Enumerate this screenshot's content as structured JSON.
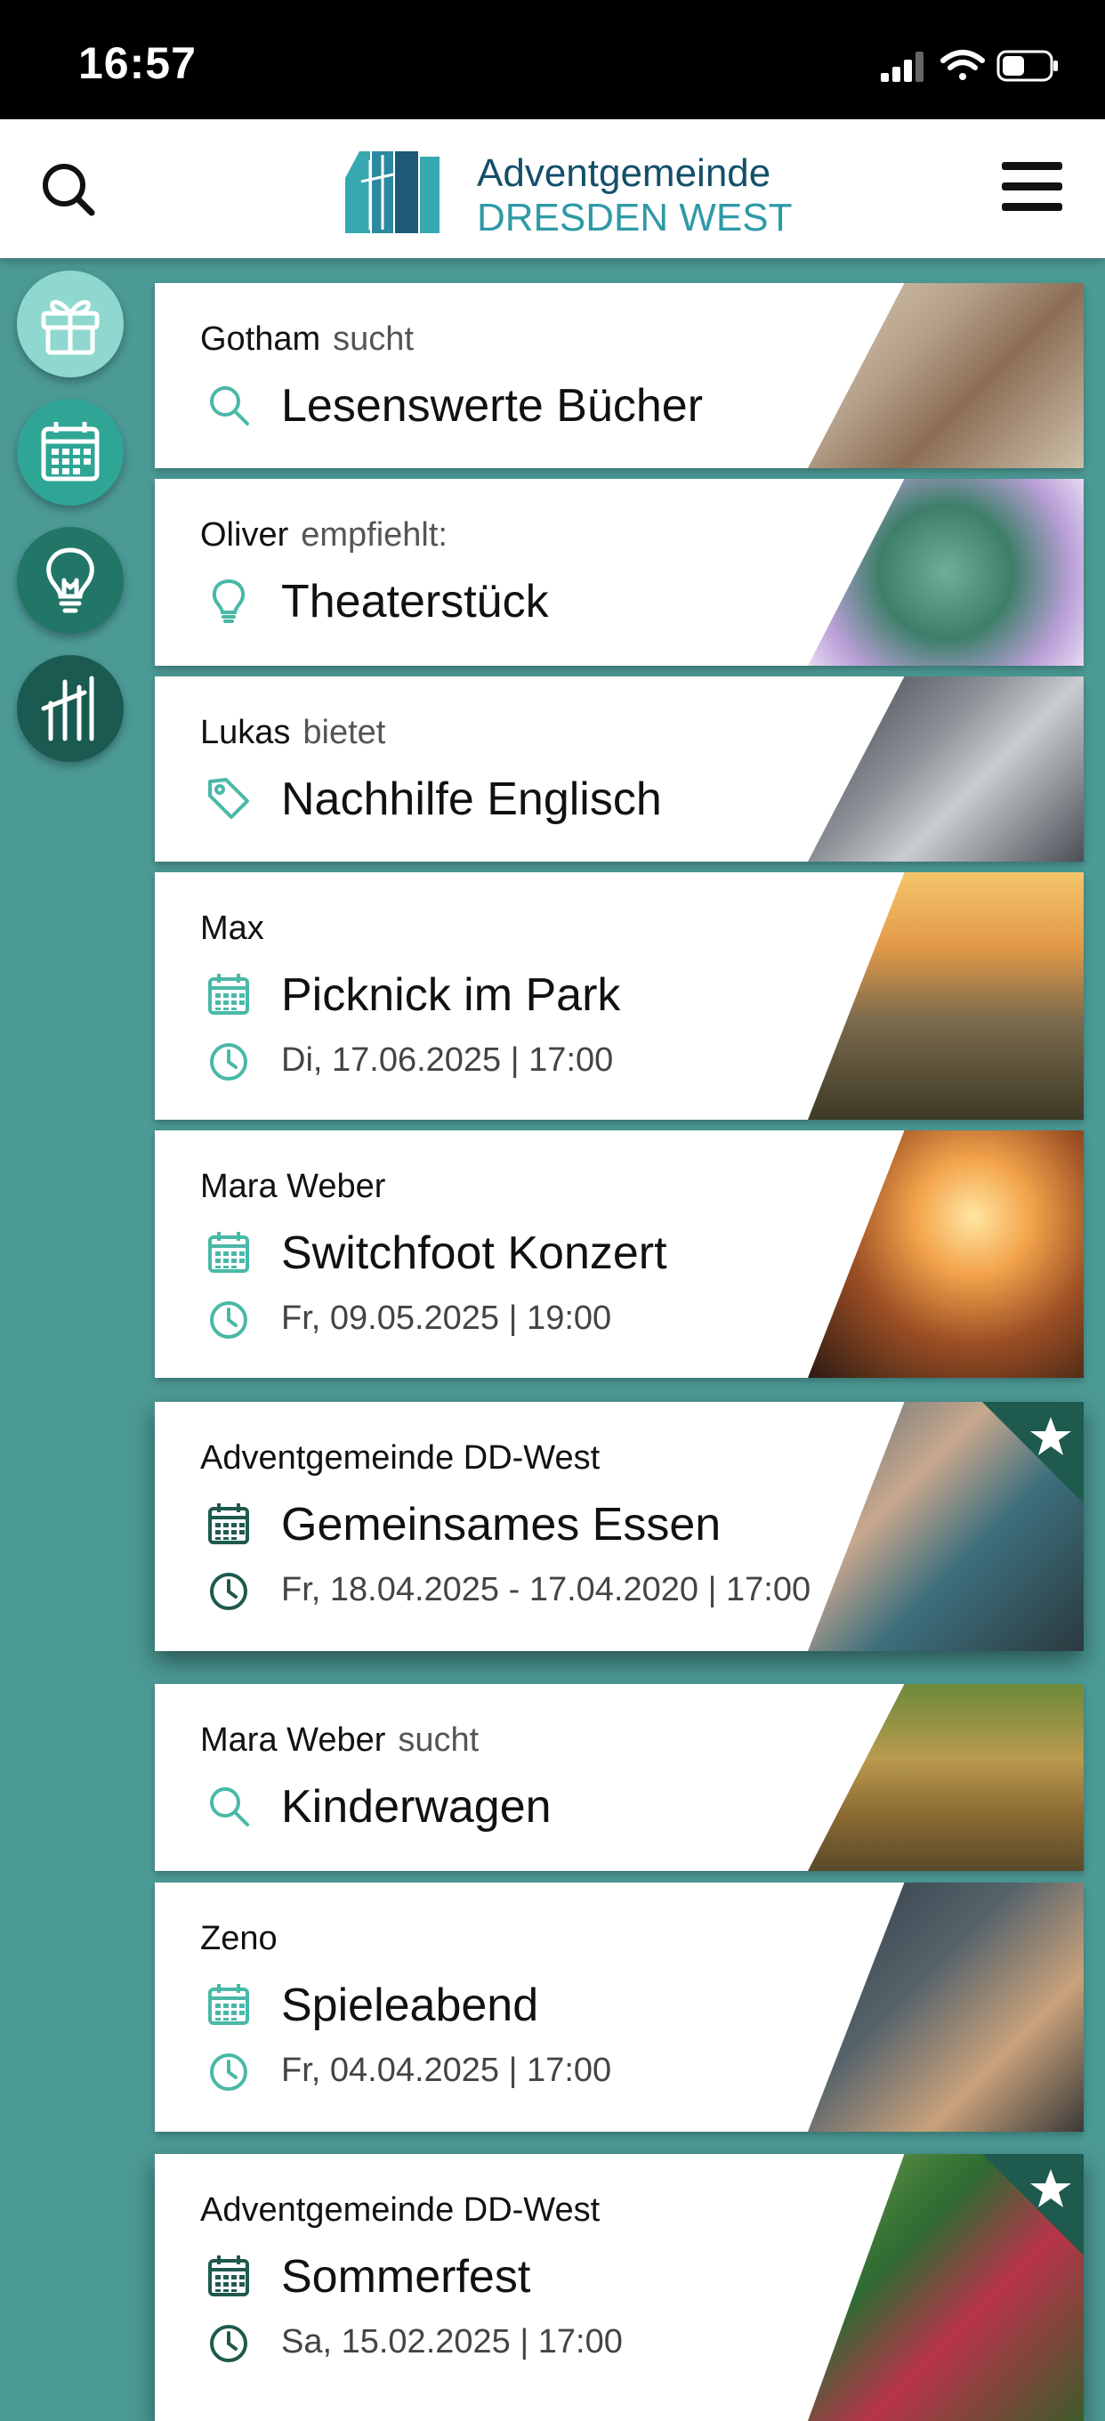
{
  "status_bar": {
    "time": "16:57"
  },
  "header": {
    "logo_line1": "Adventgemeinde",
    "logo_line2": "DRESDEN WEST"
  },
  "sidebar": [
    {
      "name": "gift-icon",
      "color": "#8fd8cf"
    },
    {
      "name": "calendar-icon",
      "color": "#2fa595"
    },
    {
      "name": "lightbulb-icon",
      "color": "#217667"
    },
    {
      "name": "church-logo-icon",
      "color": "#1a5a50"
    }
  ],
  "cards": [
    {
      "author": "Gotham",
      "verb": "sucht",
      "type_icon": "search-icon",
      "title": "Lesenswerte Bücher",
      "date": "",
      "featured": false,
      "photo": "book-pages-photo"
    },
    {
      "author": "Oliver",
      "verb": "empfiehlt:",
      "type_icon": "lightbulb-icon",
      "title": "Theaterstück",
      "date": "",
      "featured": false,
      "photo": "succulent-photo"
    },
    {
      "author": "Lukas",
      "verb": "bietet",
      "type_icon": "tag-icon",
      "title": "Nachhilfe Englisch",
      "date": "",
      "featured": false,
      "photo": "writing-desk-photo"
    },
    {
      "author": "Max",
      "verb": "",
      "type_icon": "calendar-icon",
      "title": "Picknick im Park",
      "date": "Di, 17.06.2025 | 17:00",
      "featured": false,
      "photo": "picnic-skyline-photo"
    },
    {
      "author": "Mara Weber",
      "verb": "",
      "type_icon": "calendar-icon",
      "title": "Switchfoot Konzert",
      "date": "Fr, 09.05.2025 | 19:00",
      "featured": false,
      "photo": "concert-crowd-photo"
    },
    {
      "author": "Adventgemeinde DD-West",
      "verb": "",
      "type_icon": "calendar-icon",
      "title": "Gemeinsames Essen",
      "date": "Fr, 18.04.2025 - 17.04.2020 | 17:00",
      "featured": true,
      "photo": "women-laughing-photo"
    },
    {
      "author": "Mara Weber",
      "verb": "sucht",
      "type_icon": "search-icon",
      "title": "Kinderwagen",
      "date": "",
      "featured": false,
      "photo": "family-walk-photo"
    },
    {
      "author": "Zeno",
      "verb": "",
      "type_icon": "calendar-icon",
      "title": "Spieleabend",
      "date": "Fr, 04.04.2025 | 17:00",
      "featured": false,
      "photo": "chess-game-photo"
    },
    {
      "author": "Adventgemeinde DD-West",
      "verb": "",
      "type_icon": "calendar-icon",
      "title": "Sommerfest",
      "date": "Sa, 15.02.2025 | 17:00",
      "featured": true,
      "photo": "berries-garden-photo"
    }
  ],
  "colors": {
    "accent_light": "#49b9a7",
    "accent_dark": "#1e5a4e",
    "background": "#4c9a96"
  }
}
